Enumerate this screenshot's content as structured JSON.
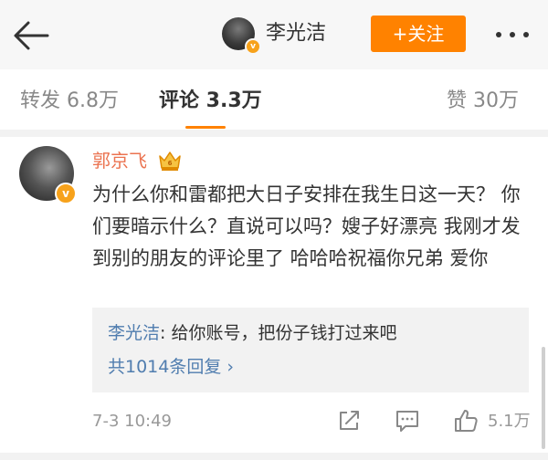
{
  "header": {
    "author_name": "李光洁",
    "follow_label": "+关注",
    "accent_color": "#ff8200",
    "icons": {
      "back": "back-arrow-icon",
      "more": "more-icon",
      "verified": "verified-badge-icon"
    }
  },
  "tabs": {
    "repost": "转发 6.8万",
    "comment": "评论 3.3万",
    "like": "赞 30万",
    "active": "comment"
  },
  "comment": {
    "author": "郭京飞",
    "text": "为什么你和雷都把大日子安排在我生日这一天？ 你们要暗示什么？直说可以吗？嫂子好漂亮 我刚才发到别的朋友的评论里了 哈哈哈祝福你兄弟 爱你",
    "reply": {
      "author": "李光洁",
      "separator": ":",
      "text": " 给你账号，把份子钱打过来吧"
    },
    "more_replies": "共1014条回复 ›",
    "timestamp": "7-3 10:49",
    "like_count": "5.1万",
    "icons": {
      "repost": "repost-icon",
      "comment": "comment-icon",
      "like": "thumbs-up-icon",
      "crown": "crown-badge-icon"
    }
  },
  "colors": {
    "name_link": "#eb7350",
    "reply_link": "#507daf",
    "muted": "#999999"
  }
}
